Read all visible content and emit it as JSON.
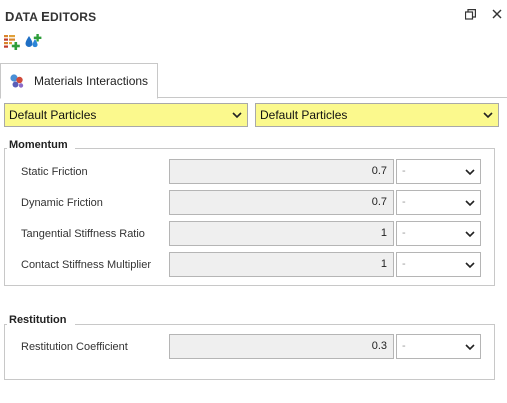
{
  "window": {
    "title_first": "D",
    "title_rest": "ATA ",
    "title_first2": "E",
    "title_rest2": "DITORS"
  },
  "toolbar": {
    "buttons": [
      {
        "icon": "add-table-icon"
      },
      {
        "icon": "add-drops-icon"
      }
    ]
  },
  "tabs": [
    {
      "label": "Materials Interactions",
      "icon": "materials-interactions-icon",
      "active": true
    }
  ],
  "selectors": {
    "left": "Default Particles",
    "right": "Default Particles",
    "highlight_color": "#fbf98d"
  },
  "groups": {
    "momentum": {
      "title": "Momentum",
      "rows": [
        {
          "label": "Static Friction",
          "value": "0.7",
          "unit": "-"
        },
        {
          "label": "Dynamic Friction",
          "value": "0.7",
          "unit": "-"
        },
        {
          "label": "Tangential Stiffness Ratio",
          "value": "1",
          "unit": "-"
        },
        {
          "label": "Contact Stiffness Multiplier",
          "value": "1",
          "unit": "-"
        }
      ]
    },
    "restitution": {
      "title": "Restitution",
      "rows": [
        {
          "label": "Restitution Coefficient",
          "value": "0.3",
          "unit": "-"
        }
      ]
    }
  }
}
